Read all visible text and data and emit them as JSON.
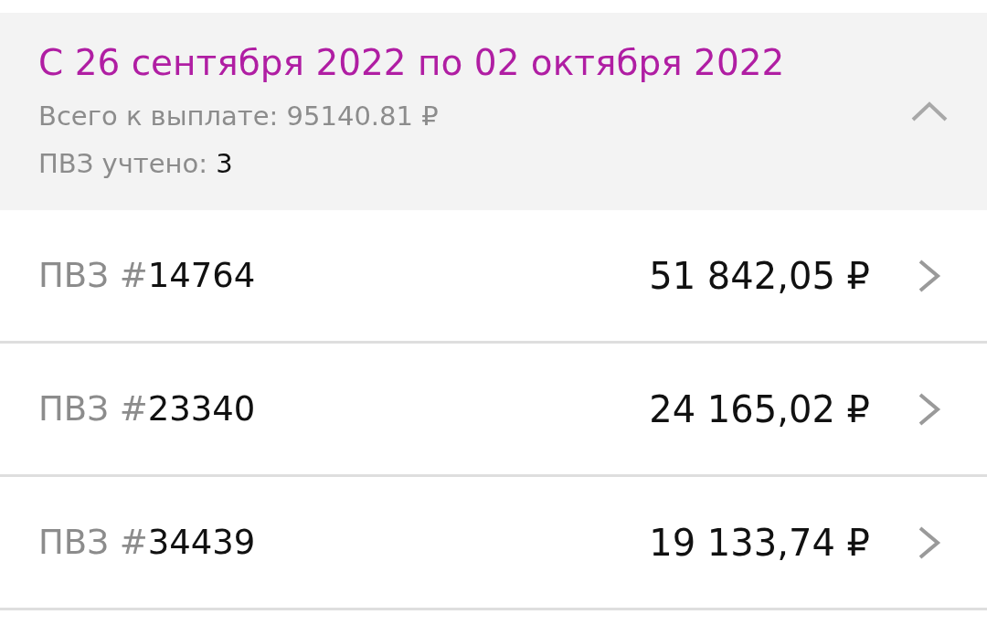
{
  "period": {
    "title": "С 26 сентября 2022 по 02 октября 2022",
    "total": "Всего к выплате: 95140.81 ₽",
    "points_label": "ПВЗ учтено: ",
    "points_count": "3",
    "expanded": true
  },
  "rows": [
    {
      "prefix": "ПВЗ #",
      "number": "14764",
      "amount": "51 842,05 ₽"
    },
    {
      "prefix": "ПВЗ #",
      "number": "23340",
      "amount": "24 165,02 ₽"
    },
    {
      "prefix": "ПВЗ #",
      "number": "34439",
      "amount": "19 133,74 ₽"
    }
  ]
}
